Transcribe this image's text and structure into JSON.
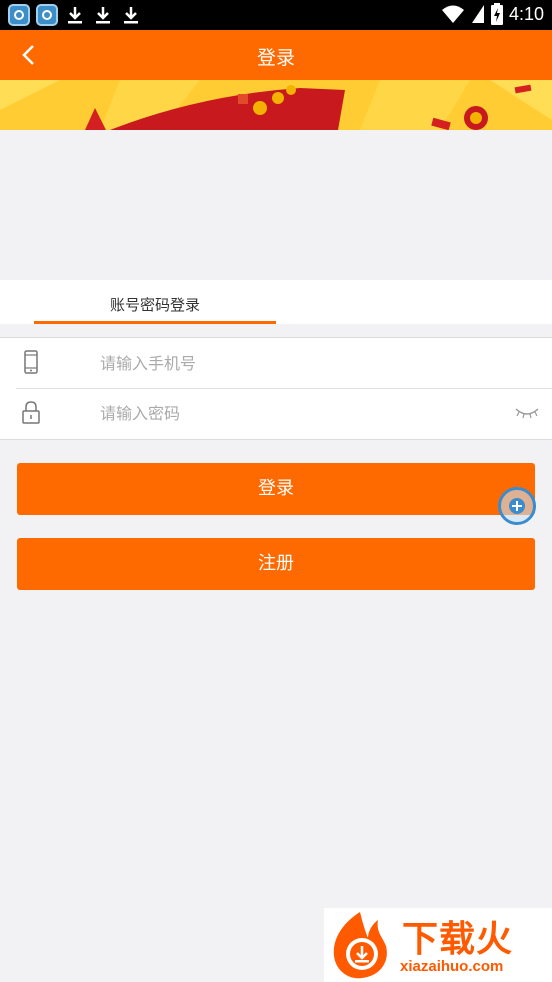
{
  "status_bar": {
    "time": "4:10",
    "left_icons": [
      "app-icon",
      "app-icon",
      "download-icon",
      "download-icon",
      "download-icon"
    ],
    "right_icons": [
      "wifi-icon",
      "signal-icon",
      "battery-icon"
    ]
  },
  "header": {
    "title": "登录",
    "back_icon": "chevron-left-icon",
    "background": "#ff6a00"
  },
  "tabs": [
    {
      "label": "账号密码登录",
      "active": true
    }
  ],
  "form": {
    "phone": {
      "placeholder": "请输入手机号",
      "value": "",
      "icon": "phone-icon"
    },
    "password": {
      "placeholder": "请输入密码",
      "value": "",
      "icon": "lock-icon",
      "toggle_icon": "eye-closed-icon"
    }
  },
  "buttons": {
    "login_label": "登录",
    "register_label": "注册"
  },
  "watermark": {
    "text": "下载火",
    "subtext": "xiazaihuo.com"
  },
  "colors": {
    "accent": "#ff6a00",
    "background": "#f2f2f5"
  }
}
